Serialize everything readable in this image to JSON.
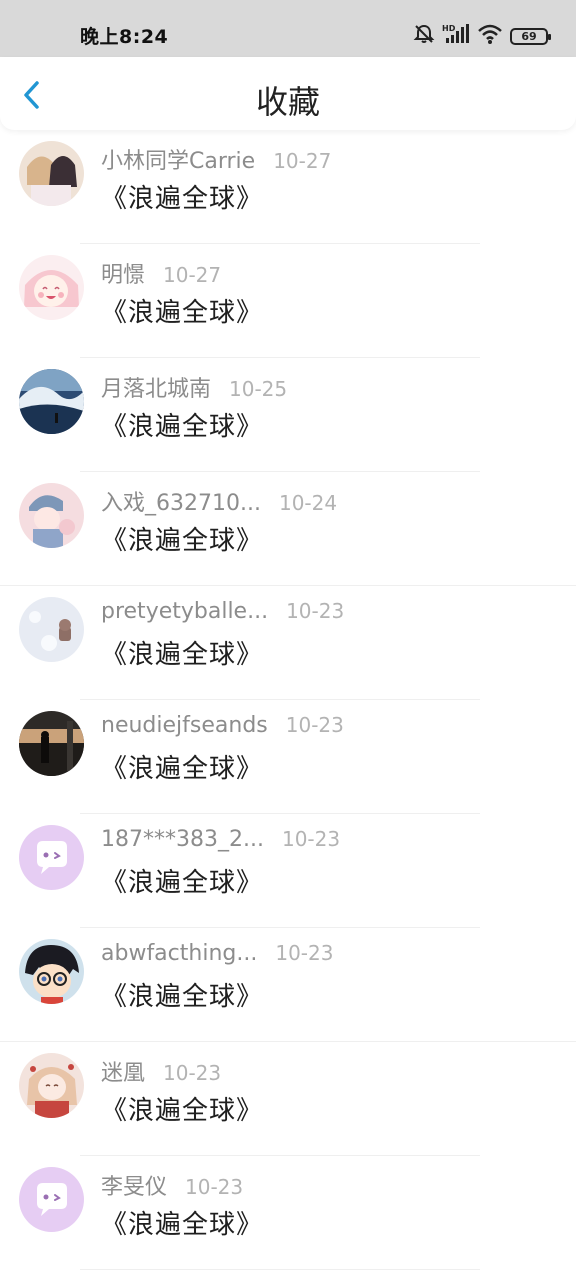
{
  "status_bar": {
    "time": "晚上8:24",
    "battery": "69",
    "icons": [
      "mute-icon",
      "hd-signal-icon",
      "wifi-icon",
      "battery-icon"
    ]
  },
  "header": {
    "title": "收藏",
    "back_icon": "chevron-left-icon",
    "accent_color": "#2196d3"
  },
  "favorites": [
    {
      "user": "小林同学Carrie",
      "date": "10-27",
      "title": "《浪遍全球》",
      "avatar": "anime-girls-avatar"
    },
    {
      "user": "明憬",
      "date": "10-27",
      "title": "《浪遍全球》",
      "avatar": "anime-pink-girl-avatar"
    },
    {
      "user": "月落北城南",
      "date": "10-25",
      "title": "《浪遍全球》",
      "avatar": "ocean-wave-avatar"
    },
    {
      "user": "入戏_632710...",
      "date": "10-24",
      "title": "《浪遍全球》",
      "avatar": "boy-cap-avatar"
    },
    {
      "user": "pretyetyballe...",
      "date": "10-23",
      "title": "《浪遍全球》",
      "avatar": "snow-bear-avatar"
    },
    {
      "user": "neudiejfseands",
      "date": "10-23",
      "title": "《浪遍全球》",
      "avatar": "sunset-figure-avatar"
    },
    {
      "user": "187***383_2...",
      "date": "10-23",
      "title": "《浪遍全球》",
      "avatar": "default-chat-avatar"
    },
    {
      "user": "abwfacthing...",
      "date": "10-23",
      "title": "《浪遍全球》",
      "avatar": "conan-avatar"
    },
    {
      "user": "迷凰",
      "date": "10-23",
      "title": "《浪遍全球》",
      "avatar": "red-dress-girl-avatar"
    },
    {
      "user": "李旻仪",
      "date": "10-23",
      "title": "《浪遍全球》",
      "avatar": "default-chat-avatar"
    }
  ]
}
